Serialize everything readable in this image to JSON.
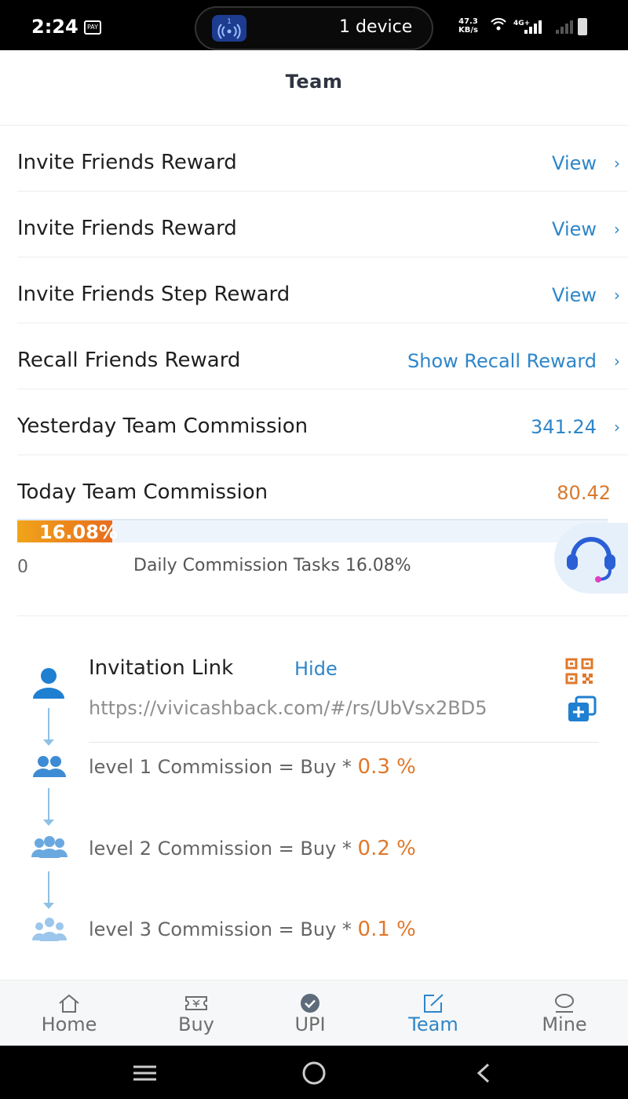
{
  "status_bar": {
    "time": "2:24",
    "pay_badge": "PAY",
    "hotspot_count": "1",
    "device_text": "1 device",
    "speed_value": "47.3",
    "speed_unit": "KB/s",
    "network": "4G+"
  },
  "header": {
    "title": "Team"
  },
  "menu": [
    {
      "label": "Invite Friends Reward",
      "value": "View"
    },
    {
      "label": "Invite Friends Reward",
      "value": "View"
    },
    {
      "label": "Invite Friends Step Reward",
      "value": "View"
    },
    {
      "label": "Recall Friends Reward",
      "value": "Show Recall Reward"
    },
    {
      "label": "Yesterday Team Commission",
      "value": "341.24"
    },
    {
      "label": "Today Team Commission",
      "value": "80.42"
    }
  ],
  "progress": {
    "percent_label": "16.08%",
    "fraction": 0.1608,
    "min_label": "0",
    "caption": "Daily Commission Tasks 16.08%"
  },
  "invitation": {
    "title": "Invitation Link",
    "hide_label": "Hide",
    "url": "https://vivicashback.com/#/rs/UbVsx2BD5",
    "levels": [
      {
        "text": "level 1 Commission = Buy * ",
        "rate": "0.3 %"
      },
      {
        "text": "level 2 Commission = Buy * ",
        "rate": "0.2 %"
      },
      {
        "text": "level 3 Commission = Buy * ",
        "rate": "0.1 %"
      }
    ]
  },
  "tabs": [
    {
      "label": "Home",
      "icon": "home-icon"
    },
    {
      "label": "Buy",
      "icon": "ticket-icon"
    },
    {
      "label": "UPI",
      "icon": "check-circle-icon"
    },
    {
      "label": "Team",
      "icon": "edit-square-icon",
      "active": true
    },
    {
      "label": "Mine",
      "icon": "user-icon"
    }
  ],
  "colors": {
    "accent_blue": "#2e86c9",
    "accent_orange": "#d9792a",
    "progress_start": "#f0a41a",
    "progress_end": "#e86d1e"
  }
}
